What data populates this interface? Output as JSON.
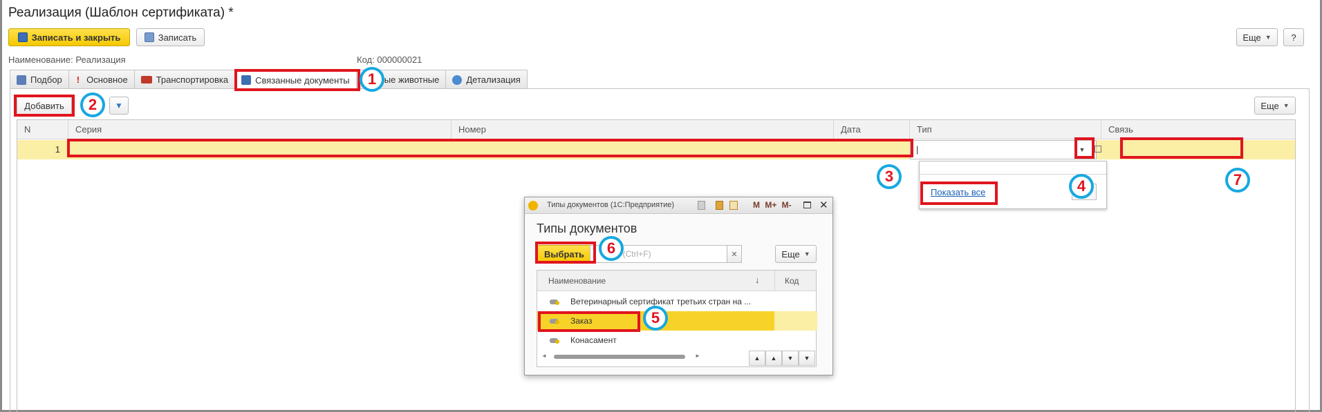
{
  "window": {
    "title": "Реализация (Шаблон сертификата) *"
  },
  "toolbar": {
    "save_close": "Записать и закрыть",
    "save": "Записать",
    "more": "Еще",
    "help": "?"
  },
  "fields": {
    "name_label": "Наименование:",
    "name_value": "Реализация",
    "code_label": "Код:",
    "code_value": "000000021"
  },
  "tabs": [
    {
      "label": "Подбор",
      "icon": "picker-icon"
    },
    {
      "label": "Основное",
      "icon": "exclamation-icon"
    },
    {
      "label": "Транспортировка",
      "icon": "truck-icon"
    },
    {
      "label": "Связанные документы",
      "icon": "linked-docs-icon",
      "active": true
    },
    {
      "label": "Живые животные",
      "icon": "none"
    },
    {
      "label": "Детализация",
      "icon": "gear-icon"
    }
  ],
  "panel": {
    "add": "Добавить",
    "more": "Еще"
  },
  "grid": {
    "headers": [
      "N",
      "Серия",
      "Номер",
      "Дата",
      "Тип",
      "Связь"
    ],
    "rows": [
      {
        "n": "1",
        "series": "",
        "number": "",
        "date": "",
        "type": "|",
        "link": ""
      }
    ]
  },
  "dropdown": {
    "show_all": "Показать все"
  },
  "dialog": {
    "window_title": "Типы документов  (1С:Предприятие)",
    "title_icons": "M M+ M-",
    "heading": "Типы документов",
    "select": "Выбрать",
    "search_placeholder": "к (Ctrl+F)",
    "more": "Еще",
    "col_name": "Наименование",
    "sort_mark": "↓",
    "col_code": "Код",
    "items": [
      "Ветеринарный сертификат третьих стран на ...",
      "Заказ",
      "Конасамент"
    ]
  },
  "callouts": [
    "1",
    "2",
    "3",
    "4",
    "5",
    "6",
    "7"
  ],
  "colors": {
    "accent_yellow": "#f5c800",
    "selected_row": "#fbeea5",
    "highlight_red": "#e0151e",
    "badge_blue": "#18a8e0",
    "link_blue": "#1a5fb4"
  }
}
